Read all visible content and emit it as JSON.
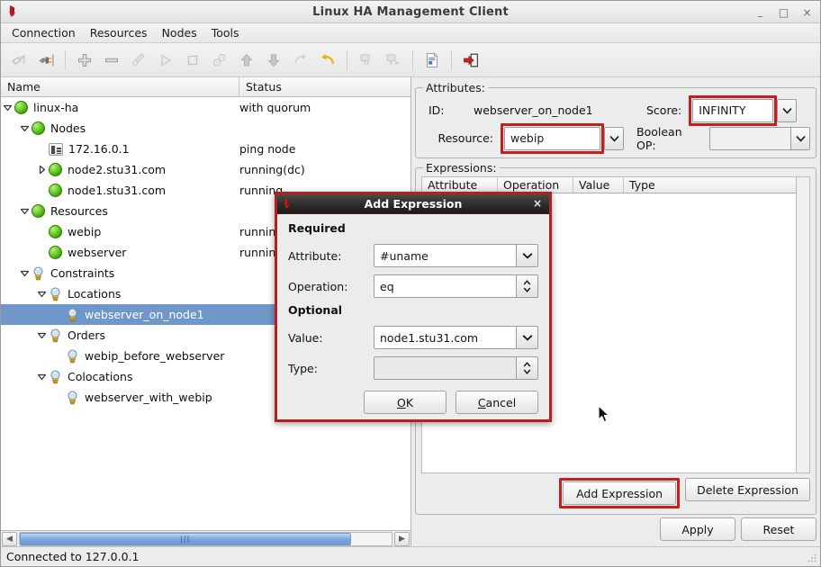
{
  "window": {
    "title": "Linux HA Management Client",
    "app_icon": "app-logo-icon",
    "minimize": "–",
    "maximize": "□",
    "close": "×"
  },
  "menubar": {
    "items": [
      {
        "label": "Connection"
      },
      {
        "label": "Resources"
      },
      {
        "label": "Nodes"
      },
      {
        "label": "Tools"
      }
    ]
  },
  "toolbar": {
    "buttons": [
      {
        "name": "disconnect-icon",
        "enabled": false
      },
      {
        "name": "connect-plug-icon",
        "enabled": true
      },
      {
        "name": "add-plus-icon",
        "enabled": true
      },
      {
        "name": "remove-minus-icon",
        "enabled": true
      },
      {
        "name": "cleanup-brush-icon",
        "enabled": false
      },
      {
        "name": "start-play-icon",
        "enabled": false
      },
      {
        "name": "stop-square-icon",
        "enabled": false
      },
      {
        "name": "manage-gears-icon",
        "enabled": false
      },
      {
        "name": "move-up-arrow-icon",
        "enabled": true
      },
      {
        "name": "move-down-arrow-icon",
        "enabled": true
      },
      {
        "name": "migrate-arrow-icon",
        "enabled": false
      },
      {
        "name": "undo-arrow-icon",
        "enabled": true
      },
      {
        "name": "standby-node-icon",
        "enabled": false
      },
      {
        "name": "activate-node-icon",
        "enabled": false
      },
      {
        "name": "cib-document-icon",
        "enabled": true
      },
      {
        "name": "exit-door-icon",
        "enabled": true
      }
    ]
  },
  "tree": {
    "columns": [
      "Name",
      "Status"
    ],
    "rows": [
      {
        "label": "linux-ha",
        "status": "with quorum",
        "depth": 0,
        "icon": "status-dot-green",
        "expander": "down",
        "selected": false
      },
      {
        "label": "Nodes",
        "status": "",
        "depth": 1,
        "icon": "status-dot-green",
        "expander": "down",
        "selected": false
      },
      {
        "label": "172.16.0.1",
        "status": "ping node",
        "depth": 2,
        "icon": "ping-node-icon",
        "expander": "none",
        "selected": false
      },
      {
        "label": "node2.stu31.com",
        "status": "running(dc)",
        "depth": 2,
        "icon": "status-dot-green",
        "expander": "right",
        "selected": false
      },
      {
        "label": "node1.stu31.com",
        "status": "running",
        "depth": 2,
        "icon": "status-dot-green",
        "expander": "none",
        "selected": false
      },
      {
        "label": "Resources",
        "status": "",
        "depth": 1,
        "icon": "status-dot-green",
        "expander": "down",
        "selected": false
      },
      {
        "label": "webip",
        "status": "running",
        "depth": 2,
        "icon": "status-dot-green",
        "expander": "none",
        "selected": false
      },
      {
        "label": "webserver",
        "status": "running",
        "depth": 2,
        "icon": "status-dot-green",
        "expander": "none",
        "selected": false
      },
      {
        "label": "Constraints",
        "status": "",
        "depth": 1,
        "icon": "lightbulb-icon",
        "expander": "down",
        "selected": false
      },
      {
        "label": "Locations",
        "status": "",
        "depth": 2,
        "icon": "lightbulb-icon",
        "expander": "down",
        "selected": false
      },
      {
        "label": "webserver_on_node1",
        "status": "",
        "depth": 3,
        "icon": "lightbulb-icon",
        "expander": "none",
        "selected": true
      },
      {
        "label": "Orders",
        "status": "",
        "depth": 2,
        "icon": "lightbulb-icon",
        "expander": "down",
        "selected": false
      },
      {
        "label": "webip_before_webserver",
        "status": "",
        "depth": 3,
        "icon": "lightbulb-icon",
        "expander": "none",
        "selected": false
      },
      {
        "label": "Colocations",
        "status": "",
        "depth": 2,
        "icon": "lightbulb-icon",
        "expander": "down",
        "selected": false
      },
      {
        "label": "webserver_with_webip",
        "status": "",
        "depth": 3,
        "icon": "lightbulb-icon",
        "expander": "none",
        "selected": false
      }
    ]
  },
  "attributes": {
    "legend": "Attributes:",
    "id_label": "ID:",
    "id_value": "webserver_on_node1",
    "score_label": "Score:",
    "score_value": "INFINITY",
    "resource_label": "Resource:",
    "resource_value": "webip",
    "boolean_label": "Boolean OP:",
    "boolean_value": ""
  },
  "expressions": {
    "legend": "Expressions:",
    "columns": [
      "Attribute",
      "Operation",
      "Value",
      "Type"
    ],
    "rows": []
  },
  "buttons": {
    "add_expression": "Add Expression",
    "delete_expression": "Delete Expression",
    "apply": "Apply",
    "reset": "Reset"
  },
  "statusbar": {
    "text": "Connected to 127.0.0.1"
  },
  "dialog": {
    "title": "Add Expression",
    "close": "×",
    "required_label": "Required",
    "optional_label": "Optional",
    "attribute_label": "Attribute:",
    "attribute_value": "#uname",
    "operation_label": "Operation:",
    "operation_value": "eq",
    "value_label": "Value:",
    "value_value": "node1.stu31.com",
    "type_label": "Type:",
    "type_value": "",
    "ok_label": "OK",
    "ok_accel": "O",
    "cancel_label": "Cancel",
    "cancel_accel": "C"
  },
  "colors": {
    "highlight_red": "#c0211e",
    "dialog_border_red": "#b3201d",
    "selection_blue": "#6f97c9",
    "status_green": "#3f9a11",
    "window_bg": "#ececec"
  }
}
